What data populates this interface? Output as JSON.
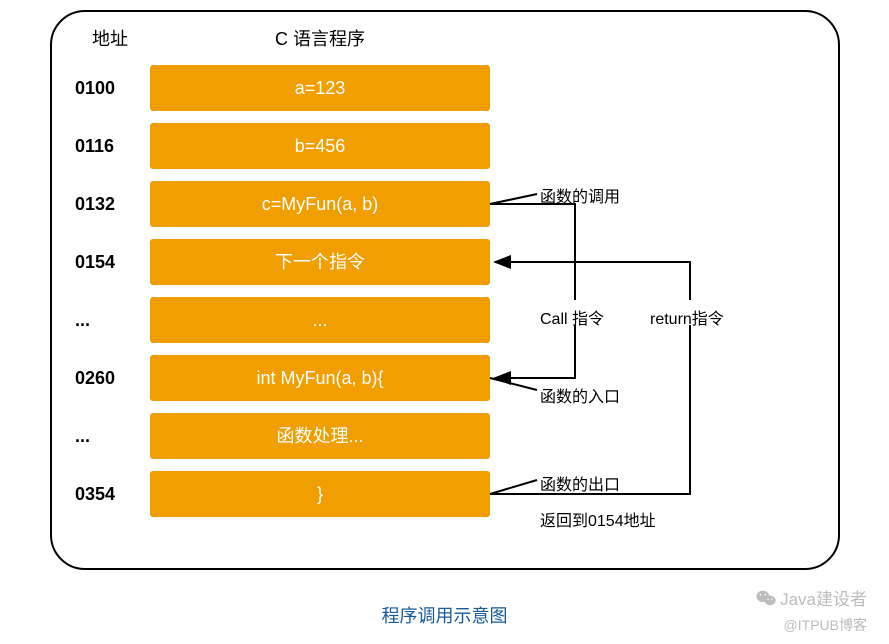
{
  "headers": {
    "address": "地址",
    "program": "C 语言程序"
  },
  "rows": [
    {
      "addr": "0100",
      "prog": "a=123"
    },
    {
      "addr": "0116",
      "prog": "b=456"
    },
    {
      "addr": "0132",
      "prog": "c=MyFun(a, b)"
    },
    {
      "addr": "0154",
      "prog": "下一个指令"
    },
    {
      "addr": "...",
      "prog": "..."
    },
    {
      "addr": "0260",
      "prog": "int MyFun(a, b){"
    },
    {
      "addr": "...",
      "prog": "函数处理..."
    },
    {
      "addr": "0354",
      "prog": "}"
    }
  ],
  "annotations": {
    "function_call": "函数的调用",
    "call_instr": "Call 指令",
    "return_instr": "return指令",
    "function_entry": "函数的入口",
    "function_exit": "函数的出口",
    "return_to": "返回到0154地址"
  },
  "caption": "程序调用示意图",
  "watermark": {
    "top": "Java建设者",
    "bottom": "@ITPUB博客"
  },
  "colors": {
    "block_bg": "#F19E00",
    "block_fg": "#FFFFFF",
    "caption": "#155b97"
  }
}
